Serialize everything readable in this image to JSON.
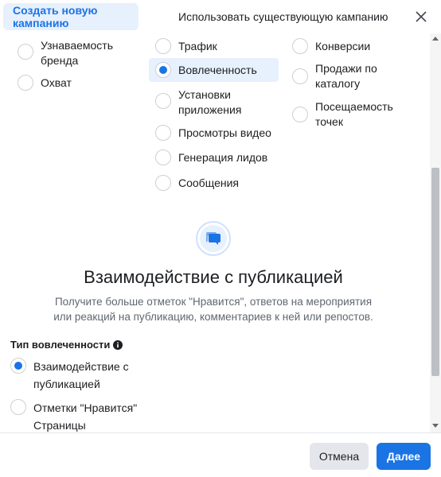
{
  "header": {
    "tab_create": "Создать новую кампанию",
    "tab_existing": "Использовать существующую кампанию"
  },
  "objectives": {
    "col1": [
      {
        "label_lines": [
          "Узнаваемость",
          "бренда"
        ],
        "selected": false
      },
      {
        "label_lines": [
          "Охват"
        ],
        "selected": false
      }
    ],
    "col2": [
      {
        "label_lines": [
          "Трафик"
        ],
        "selected": false
      },
      {
        "label_lines": [
          "Вовлеченность"
        ],
        "selected": true
      },
      {
        "label_lines": [
          "Установки",
          "приложения"
        ],
        "selected": false
      },
      {
        "label_lines": [
          "Просмотры видео"
        ],
        "selected": false
      },
      {
        "label_lines": [
          "Генерация лидов"
        ],
        "selected": false
      },
      {
        "label_lines": [
          "Сообщения"
        ],
        "selected": false
      }
    ],
    "col3": [
      {
        "label_lines": [
          "Конверсии"
        ],
        "selected": false
      },
      {
        "label_lines": [
          "Продажи по",
          "каталогу"
        ],
        "selected": false
      },
      {
        "label_lines": [
          "Посещаемость",
          "точек"
        ],
        "selected": false
      }
    ]
  },
  "detail": {
    "icon": "chat-bubbles-icon",
    "title": "Взаимодействие с публикацией",
    "description_lines": [
      "Получите больше отметок \"Нравится\", ответов на мероприятия",
      "или реакций на публикацию, комментариев к ней или репостов."
    ]
  },
  "engagement_type": {
    "label": "Тип вовлеченности",
    "options": [
      {
        "label_lines": [
          "Взаимодействие с",
          "публикацией"
        ],
        "selected": true
      },
      {
        "label_lines": [
          "Отметки \"Нравится\"",
          "Страницы"
        ],
        "selected": false
      }
    ]
  },
  "footer": {
    "cancel": "Отмена",
    "next": "Далее"
  },
  "colors": {
    "accent": "#1b74e4",
    "selected_bg": "#e7f0fd"
  }
}
